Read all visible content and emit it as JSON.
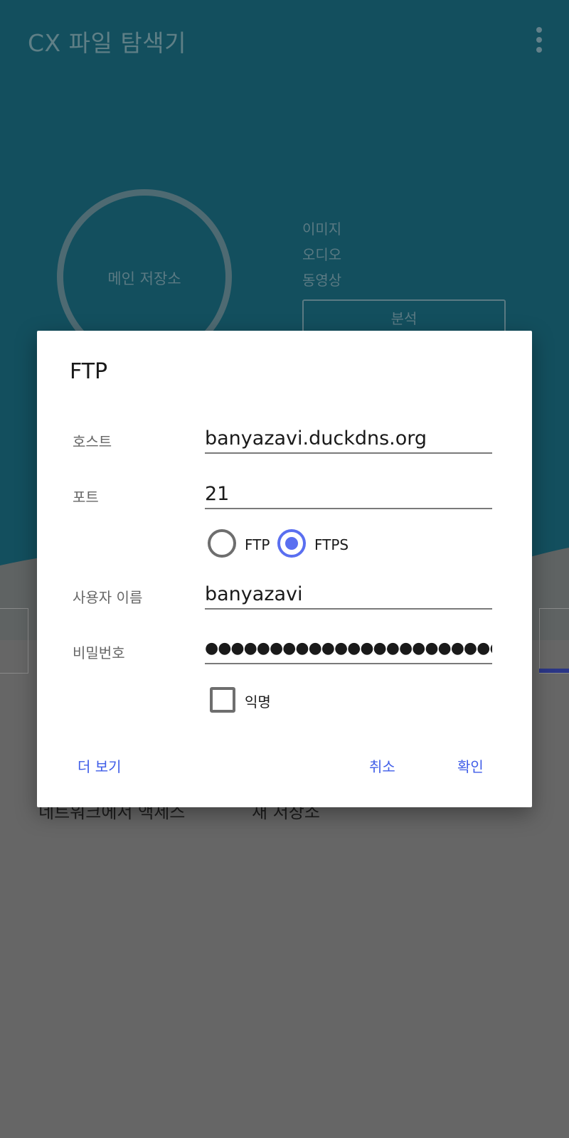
{
  "app": {
    "title": "CX 파일 탐색기",
    "storage_label": "메인 저장소",
    "legend": [
      "이미지",
      "오디오",
      "동영상"
    ],
    "analyze_label": "분석",
    "bottom_items": [
      "네트워크에서 액세스",
      "새 저장소"
    ]
  },
  "dialog": {
    "title": "FTP",
    "host_label": "호스트",
    "host_value": "banyazavi.duckdns.org",
    "port_label": "포트",
    "port_value": "21",
    "protocol_options": [
      "FTP",
      "FTPS"
    ],
    "protocol_selected": "FTPS",
    "username_label": "사용자 이름",
    "username_value": "banyazavi",
    "password_label": "비밀번호",
    "password_mask": "●●●●●●●●●●●●●●●●●●●●●●●●●●●●●●●●●●●●●●",
    "anonymous_label": "익명",
    "anonymous_checked": false,
    "more_label": "더 보기",
    "cancel_label": "취소",
    "ok_label": "확인"
  },
  "colors": {
    "app_bar": "#134f5e",
    "accent": "#5a6ff0",
    "button_text": "#3f5de8",
    "scrim_bg": "#666666"
  }
}
